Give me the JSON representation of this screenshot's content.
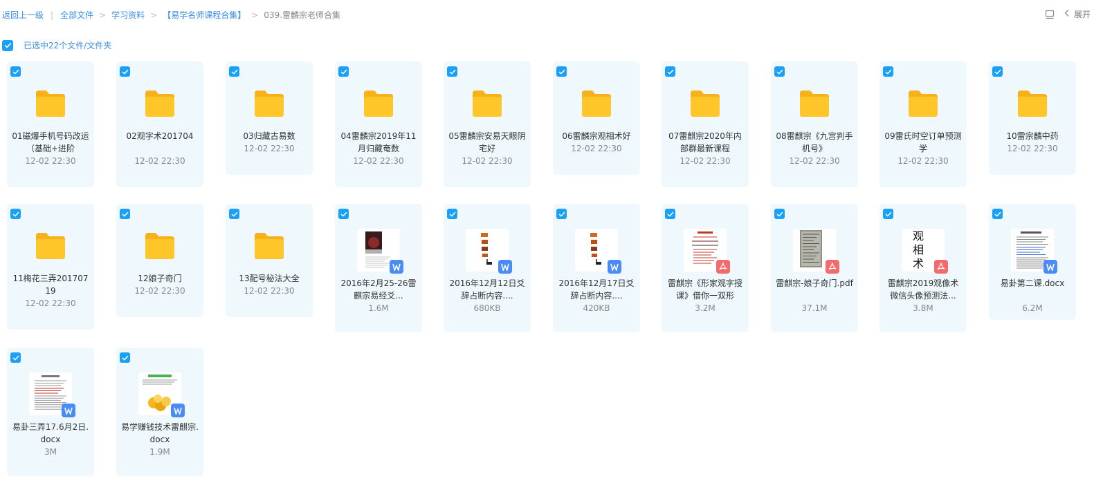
{
  "breadcrumb": {
    "back": "返回上一级",
    "items": [
      "全部文件",
      "学习资料",
      "【易学名师课程合集】"
    ],
    "current": "039.雷麟宗老师合集"
  },
  "toolbar": {
    "expand_label": "展开"
  },
  "selection": {
    "text": "已选中22个文件/文件夹",
    "checked": true
  },
  "colors": {
    "accent": "#1aa1f5",
    "link": "#3a8ee6",
    "card_bg": "#eef8fd",
    "folder": "#ffc629",
    "word_badge": "#4a8cf7",
    "pdf_badge": "#f56a6a"
  },
  "files": [
    {
      "name": "01磁爆手机号码改运（基础+进阶",
      "meta": "12-02 22:30",
      "kind": "folder",
      "checked": true
    },
    {
      "name": "02观字术201704",
      "meta": "12-02 22:30",
      "kind": "folder",
      "checked": true
    },
    {
      "name": "03归藏古易数",
      "meta": "12-02 22:30",
      "kind": "folder",
      "checked": true
    },
    {
      "name": "04雷麟宗2019年11月归藏奄数",
      "meta": "12-02 22:30",
      "kind": "folder",
      "checked": true
    },
    {
      "name": "05雷麟宗安易天眼阴宅好",
      "meta": "12-02 22:30",
      "kind": "folder",
      "checked": true
    },
    {
      "name": "06雷麟宗观相术好",
      "meta": "12-02 22:30",
      "kind": "folder",
      "checked": true
    },
    {
      "name": "07雷麒宗2020年内部群最新课程",
      "meta": "12-02 22:30",
      "kind": "folder",
      "checked": true
    },
    {
      "name": "08雷麒宗《九宫判手机号》",
      "meta": "12-02 22:30",
      "kind": "folder",
      "checked": true
    },
    {
      "name": "09雷氏时空订单预测学",
      "meta": "12-02 22:30",
      "kind": "folder",
      "checked": true
    },
    {
      "name": "10雷宗麟中药",
      "meta": "12-02 22:30",
      "kind": "folder",
      "checked": true
    },
    {
      "name": "11梅花三弄20170719",
      "meta": "12-02 22:30",
      "kind": "folder",
      "checked": true
    },
    {
      "name": "12娘子奇门",
      "meta": "12-02 22:30",
      "kind": "folder",
      "checked": true
    },
    {
      "name": "13配号秘法大全",
      "meta": "12-02 22:30",
      "kind": "folder",
      "checked": true
    },
    {
      "name": "2016年2月25-26雷麒宗易经爻...",
      "meta": "1.6M",
      "kind": "word",
      "preview": "photo",
      "checked": true
    },
    {
      "name": "2016年12月12日爻辞占断内容....",
      "meta": "680KB",
      "kind": "word",
      "preview": "vertical-red",
      "checked": true
    },
    {
      "name": "2016年12月17日爻辞占断内容....",
      "meta": "420KB",
      "kind": "word",
      "preview": "vertical-red",
      "checked": true
    },
    {
      "name": "雷麒宗《形家观字授课》借你一双形",
      "meta": "3.2M",
      "kind": "pdf",
      "preview": "red-text",
      "checked": true
    },
    {
      "name": "雷麒宗-娘子奇门.pdf",
      "meta": "37.1M",
      "kind": "pdf",
      "preview": "paper-photo",
      "checked": true
    },
    {
      "name": "雷麒宗2019观像术微信头像预测法...",
      "meta": "3.8M",
      "kind": "pdf",
      "preview": "big-chars",
      "checked": true
    },
    {
      "name": "易卦第二课.docx",
      "meta": "6.2M",
      "kind": "word",
      "preview": "text-blue",
      "checked": true
    },
    {
      "name": "易卦三弄17.6月2日.docx",
      "meta": "3M",
      "kind": "word",
      "preview": "text-red",
      "checked": true
    },
    {
      "name": "易学赚钱技术雷麒宗.docx",
      "meta": "1.9M",
      "kind": "word",
      "preview": "coins",
      "checked": true
    }
  ]
}
